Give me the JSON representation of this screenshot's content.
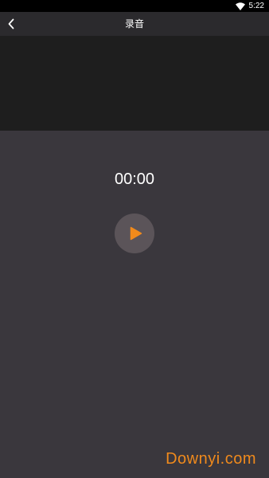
{
  "status_bar": {
    "time": "5:22",
    "wifi_icon": "wifi-icon"
  },
  "header": {
    "back_icon": "chevron-left-icon",
    "title": "录音"
  },
  "recorder": {
    "timer": "00:00",
    "play_icon": "play-icon",
    "accent_color": "#f08a1c"
  },
  "watermark": {
    "text": "Downyi.com"
  }
}
